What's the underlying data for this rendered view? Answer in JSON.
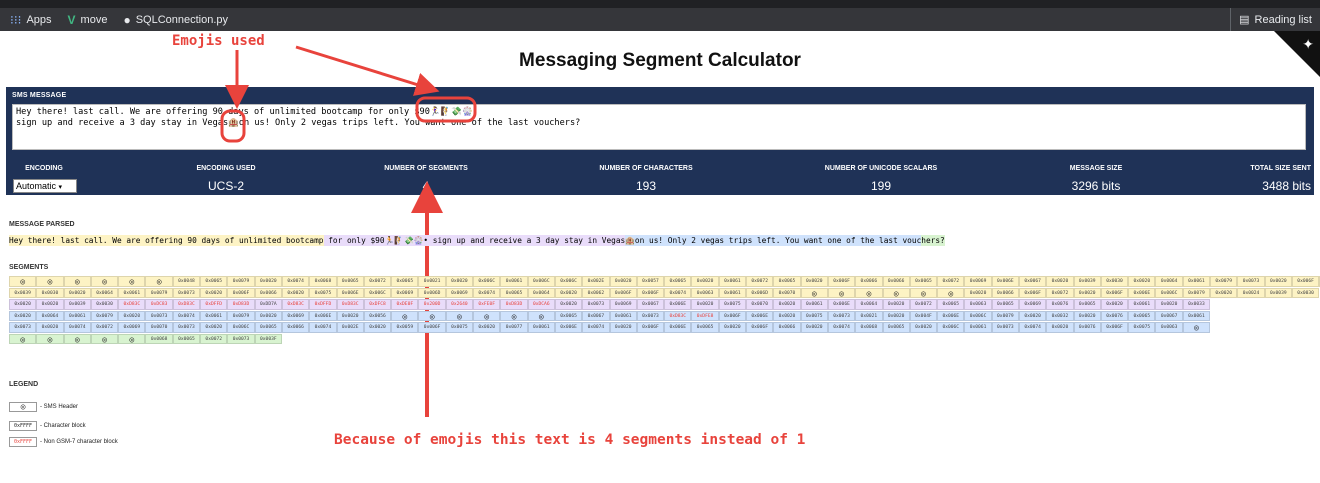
{
  "browser": {
    "bookmarks": [
      {
        "icon": "apps-grid-icon",
        "label": "Apps"
      },
      {
        "icon": "vue-logo-icon",
        "label": "move"
      },
      {
        "icon": "github-icon",
        "label": "SQLConnection.py"
      }
    ],
    "reading_list": "Reading list"
  },
  "page": {
    "title": "Messaging Segment Calculator"
  },
  "annotations": {
    "emojis_used": "Emojis used",
    "explanation": "Because of emojis this text is 4 segments instead of 1"
  },
  "sms": {
    "label": "SMS MESSAGE",
    "line1": "Hey there! last call. We are offering 90 days of unlimited bootcamp for only $90🏃‍♀️🧗💸🎡",
    "line2": "sign up and receive a 3 day stay in Vegas🏨on us! Only 2 vegas trips left. You want one of the last vouchers?"
  },
  "stats": {
    "encoding": {
      "label": "ENCODING",
      "value": "Automatic"
    },
    "encoding_used": {
      "label": "ENCODING USED",
      "value": "UCS-2"
    },
    "segments": {
      "label": "NUMBER OF SEGMENTS",
      "value": "4"
    },
    "characters": {
      "label": "NUMBER OF CHARACTERS",
      "value": "193"
    },
    "unicode": {
      "label": "NUMBER OF UNICODE SCALARS",
      "value": "199"
    },
    "message_size": {
      "label": "MESSAGE SIZE",
      "value": "3296 bits"
    },
    "total_size": {
      "label": "TOTAL SIZE SENT",
      "value": "3488 bits"
    }
  },
  "parsed": {
    "label": "MESSAGE PARSED",
    "parts": [
      "Hey there! last call. We are offering 90 days of unlimited bootcamp",
      " for only $90🏃🧗💸🎡• sign up and receive a 3 day stay in Vegas",
      "🏨on us! Only 2 vegas trips left. You want one of the last vouc",
      "hers?"
    ]
  },
  "segments": {
    "label": "SEGMENTS",
    "header_glyph": "◎",
    "rows": [
      {
        "cls": "c0",
        "cells": [
          "H",
          "H",
          "H",
          "H",
          "H",
          "H",
          "0x0048",
          "0x0065",
          "0x0079",
          "0x0020",
          "0x0074",
          "0x0068",
          "0x0065",
          "0x0072",
          "0x0065",
          "0x0021",
          "0x0020",
          "0x006C",
          "0x0061",
          "0x006C",
          "0x006C",
          "0x002E",
          "0x0020",
          "0x0057",
          "0x0065",
          "0x0020",
          "0x0061",
          "0x0072",
          "0x0065",
          "0x0020",
          "0x006F",
          "0x0066",
          "0x0066",
          "0x0065",
          "0x0072",
          "0x0069",
          "0x006E",
          "0x0067",
          "0x0020",
          "0x0039",
          "0x0030",
          "0x0020",
          "0x0064",
          "0x0061",
          "0x0079",
          "0x0073",
          "0x0020",
          "0x006F",
          "0x0066"
        ]
      },
      {
        "cls": "c0",
        "cells": [
          "0x0039",
          "0x0030",
          "0x0020",
          "0x0064",
          "0x0061",
          "0x0079",
          "0x0073",
          "0x0020",
          "0x006F",
          "0x0066",
          "0x0020",
          "0x0075",
          "0x006E",
          "0x006C",
          "0x0069",
          "0x006D",
          "0x0069",
          "0x0074",
          "0x0065",
          "0x0064",
          "0x0020",
          "0x0062",
          "0x006F",
          "0x006F",
          "0x0074",
          "0x0063",
          "0x0061",
          "0x006D",
          "0x0070",
          "H",
          "H",
          "H",
          "H",
          "H",
          "H",
          "0x0020",
          "0x0066",
          "0x006F",
          "0x0072",
          "0x0020",
          "0x006F",
          "0x006E",
          "0x006C",
          "0x0079",
          "0x0020",
          "0x0024",
          "0x0039",
          "0x0030"
        ]
      },
      {
        "cls": "c1",
        "cells": [
          "0x0020",
          "0x0020",
          "0x0039",
          "0x0030",
          "0xD83C",
          "0xDC83",
          "0xD83C",
          "0xDFFD",
          "0xD83D",
          "0xDD7A",
          "0xD83C",
          "0xDFFD",
          "0xD83C",
          "0xDFC8",
          "0xDE0F",
          "0x200D",
          "0x2640",
          "0xFE0F",
          "0xD83D",
          "0xDCA6",
          "0x0020",
          "0x0073",
          "0x0069",
          "0x0067",
          "0x006E",
          "0x0020",
          "0x0075",
          "0x0070",
          "0x0020",
          "0x0061",
          "0x006E",
          "0x0064",
          "0x0020",
          "0x0072",
          "0x0065",
          "0x0063",
          "0x0065",
          "0x0069",
          "0x0076",
          "0x0065",
          "0x0020",
          "0x0061",
          "0x0020",
          "0x0033"
        ]
      },
      {
        "cls": "c2",
        "cells": [
          "0x0020",
          "0x0064",
          "0x0061",
          "0x0079",
          "0x0020",
          "0x0073",
          "0x0074",
          "0x0061",
          "0x0079",
          "0x0020",
          "0x0069",
          "0x006E",
          "0x0020",
          "0x0056",
          "H",
          "H",
          "H",
          "H",
          "H",
          "H",
          "0x0065",
          "0x0067",
          "0x0061",
          "0x0073",
          "0xD83C",
          "0xDFE8",
          "0x006F",
          "0x006E",
          "0x0020",
          "0x0075",
          "0x0073",
          "0x0021",
          "0x0020",
          "0x004F",
          "0x006E",
          "0x006C",
          "0x0079",
          "0x0020",
          "0x0032",
          "0x0020",
          "0x0076",
          "0x0065",
          "0x0067",
          "0x0061"
        ]
      },
      {
        "cls": "c2",
        "cells": [
          "0x0073",
          "0x0020",
          "0x0074",
          "0x0072",
          "0x0069",
          "0x0070",
          "0x0073",
          "0x0020",
          "0x006C",
          "0x0065",
          "0x0066",
          "0x0074",
          "0x002E",
          "0x0020",
          "0x0059",
          "0x006F",
          "0x0075",
          "0x0020",
          "0x0077",
          "0x0061",
          "0x006E",
          "0x0074",
          "0x0020",
          "0x006F",
          "0x006E",
          "0x0065",
          "0x0020",
          "0x006F",
          "0x0066",
          "0x0020",
          "0x0074",
          "0x0068",
          "0x0065",
          "0x0020",
          "0x006C",
          "0x0061",
          "0x0073",
          "0x0074",
          "0x0020",
          "0x0076",
          "0x006F",
          "0x0075",
          "0x0063",
          "H"
        ]
      },
      {
        "cls": "c3",
        "cells": [
          "H",
          "H",
          "H",
          "H",
          "H",
          "0x0068",
          "0x0065",
          "0x0072",
          "0x0073",
          "0x003F"
        ]
      }
    ]
  },
  "legend": {
    "label": "LEGEND",
    "items": [
      {
        "swatch": "◎",
        "text": "- SMS Header"
      },
      {
        "swatch": "0xFFFF",
        "text": "- Character block"
      },
      {
        "swatch": "0xFFFF",
        "text": "- Non GSM-7 character block"
      }
    ]
  },
  "colors": {
    "panel": "#1f3257",
    "annotation": "#e8433c",
    "non_gsm": "#e8433c"
  }
}
